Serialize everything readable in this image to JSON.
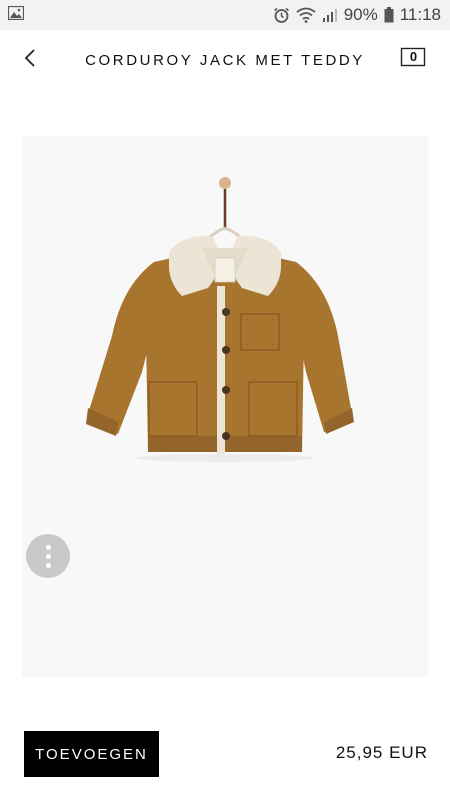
{
  "status_bar": {
    "battery_percent": "90%",
    "time": "11:18",
    "icons": [
      "image-notification-icon",
      "alarm-icon",
      "wifi-icon",
      "signal-icon",
      "battery-icon"
    ]
  },
  "header": {
    "title": "CORDUROY JACK MET TEDDY",
    "cart_count": "0",
    "icons": [
      "back-chevron-icon",
      "cart-icon"
    ]
  },
  "product": {
    "image_icon": "corduroy-jacket-image",
    "more_icon": "more-vertical-icon"
  },
  "purchase": {
    "add_label": "TOEVOEGEN",
    "price": "25,95 EUR"
  },
  "colors": {
    "status_bar_bg": "#f2f2f2",
    "image_bg": "#f8f8f8",
    "jacket": "#a8752f",
    "teddy_lining": "#ece5d5",
    "button_bg": "#000000",
    "more_button_bg": "#c9c9c9"
  }
}
